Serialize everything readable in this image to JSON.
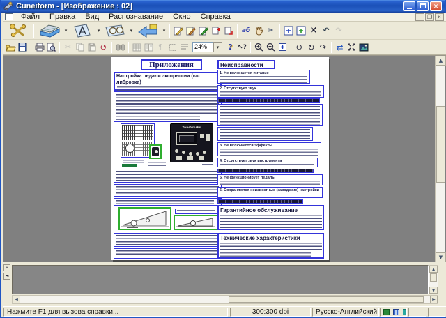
{
  "window": {
    "title": "Cuneiform - [Изображение : 02]"
  },
  "menu": {
    "items": [
      "Файл",
      "Правка",
      "Вид",
      "Распознавание",
      "Окно",
      "Справка"
    ]
  },
  "toolbar": {
    "zoom_value": "24%"
  },
  "glyphs": {
    "dropdown": "▾",
    "language": "аб",
    "scissors": "✂",
    "paragraph": "¶",
    "undo": "↶",
    "redo": "↷",
    "undo_small": "↺",
    "rotate_left": "↺",
    "rotate_180": "↻",
    "rotate_right": "↷",
    "refresh": "⇄",
    "help": "?",
    "context_help": "↖?",
    "delete_zone": "×",
    "arrow_up": "▲",
    "arrow_down": "▼",
    "arrow_left": "◄",
    "arrow_right": "►",
    "panel_close": "×",
    "panel_collapse": "◄"
  },
  "document": {
    "page_title": "Приложения",
    "left": {
      "section_heading_line1": "Настройка педали экспрессии (ка-",
      "section_heading_line2": "либровка)",
      "panel_brand": "ToneWorks"
    },
    "right": {
      "faults_heading": "Неисправности",
      "fault_1": "1. Не включается питание",
      "fault_2": "2. Отсутствует звук",
      "fault_3": "3. Не включаются эффекты",
      "fault_4": "4. Отсутствует звук инструмента",
      "fault_5": "5. Не функционирует педаль",
      "fault_6": "6. Сохраняются неизвестные (заводские) настройки",
      "warranty_heading": "Гарантийное обслуживание",
      "specs_heading": "Технические характеристики"
    }
  },
  "statusbar": {
    "hint": "Нажмите F1 для вызова справки...",
    "dpi": "300:300 dpi",
    "language": "Русско-Английский"
  }
}
